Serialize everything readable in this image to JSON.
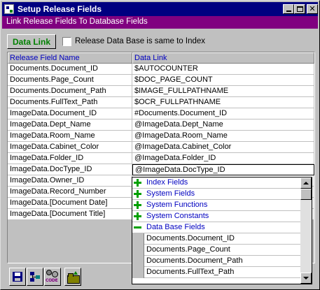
{
  "window": {
    "title": "Setup Release Fields",
    "subtitle": "Link Release Fields To Database Fields"
  },
  "title_buttons": {
    "minimize": "_",
    "maximize": "□",
    "close": "✕"
  },
  "toolbar": {
    "data_link_label": "Data Link",
    "checkbox_label": "Release Data Base is same to Index",
    "checkbox_checked": false
  },
  "grid": {
    "columns": [
      "Release Field Name",
      "Data Link"
    ],
    "rows": [
      {
        "field": "Documents.Document_ID",
        "link": "$AUTOCOUNTER"
      },
      {
        "field": "Documents.Page_Count",
        "link": "$DOC_PAGE_COUNT"
      },
      {
        "field": "Documents.Document_Path",
        "link": "$IMAGE_FULLPATHNAME"
      },
      {
        "field": "Documents.FullText_Path",
        "link": "$OCR_FULLPATHNAME"
      },
      {
        "field": "ImageData.Document_ID",
        "link": "#Documents.Document_ID"
      },
      {
        "field": "ImageData.Dept_Name",
        "link": "@ImageData.Dept_Name"
      },
      {
        "field": "ImageData.Room_Name",
        "link": "@ImageData.Room_Name"
      },
      {
        "field": "ImageData.Cabinet_Color",
        "link": "@ImageData.Cabinet_Color"
      },
      {
        "field": "ImageData.Folder_ID",
        "link": "@ImageData.Folder_ID"
      },
      {
        "field": "ImageData.DocType_ID",
        "link": "@ImageData.DocType_ID"
      },
      {
        "field": "ImageData.Owner_ID",
        "link": ""
      },
      {
        "field": "ImageData.Record_Number",
        "link": ""
      },
      {
        "field": "ImageData.[Document Date]",
        "link": ""
      },
      {
        "field": "ImageData.[Document Title]",
        "link": ""
      }
    ]
  },
  "dropdown": {
    "items": [
      {
        "kind": "group",
        "icon": "plus-icon",
        "label": "Index Fields"
      },
      {
        "kind": "group",
        "icon": "plus-icon",
        "label": "System Fields"
      },
      {
        "kind": "group",
        "icon": "plus-icon",
        "label": "System Functions"
      },
      {
        "kind": "group",
        "icon": "plus-icon",
        "label": "System Constants"
      },
      {
        "kind": "group",
        "icon": "minus-icon",
        "label": "Data Base Fields"
      },
      {
        "kind": "field",
        "icon": "",
        "label": "Documents.Document_ID"
      },
      {
        "kind": "field",
        "icon": "",
        "label": "Documents.Page_Count"
      },
      {
        "kind": "field",
        "icon": "",
        "label": "Documents.Document_Path"
      },
      {
        "kind": "field",
        "icon": "",
        "label": "Documents.FullText_Path"
      }
    ]
  },
  "bottom_toolbar": {
    "buttons": [
      {
        "icon": "save-disk-icon"
      },
      {
        "icon": "tree-structure-icon"
      },
      {
        "icon": "code-gears-icon",
        "caption": "CODE"
      },
      {
        "icon": "folder-export-icon"
      }
    ]
  },
  "colors": {
    "title_bar": "#000080",
    "subtitle_bar": "#800080",
    "data_link_text": "#008000",
    "header_text": "#0000c0",
    "face": "#c0c0c0"
  }
}
